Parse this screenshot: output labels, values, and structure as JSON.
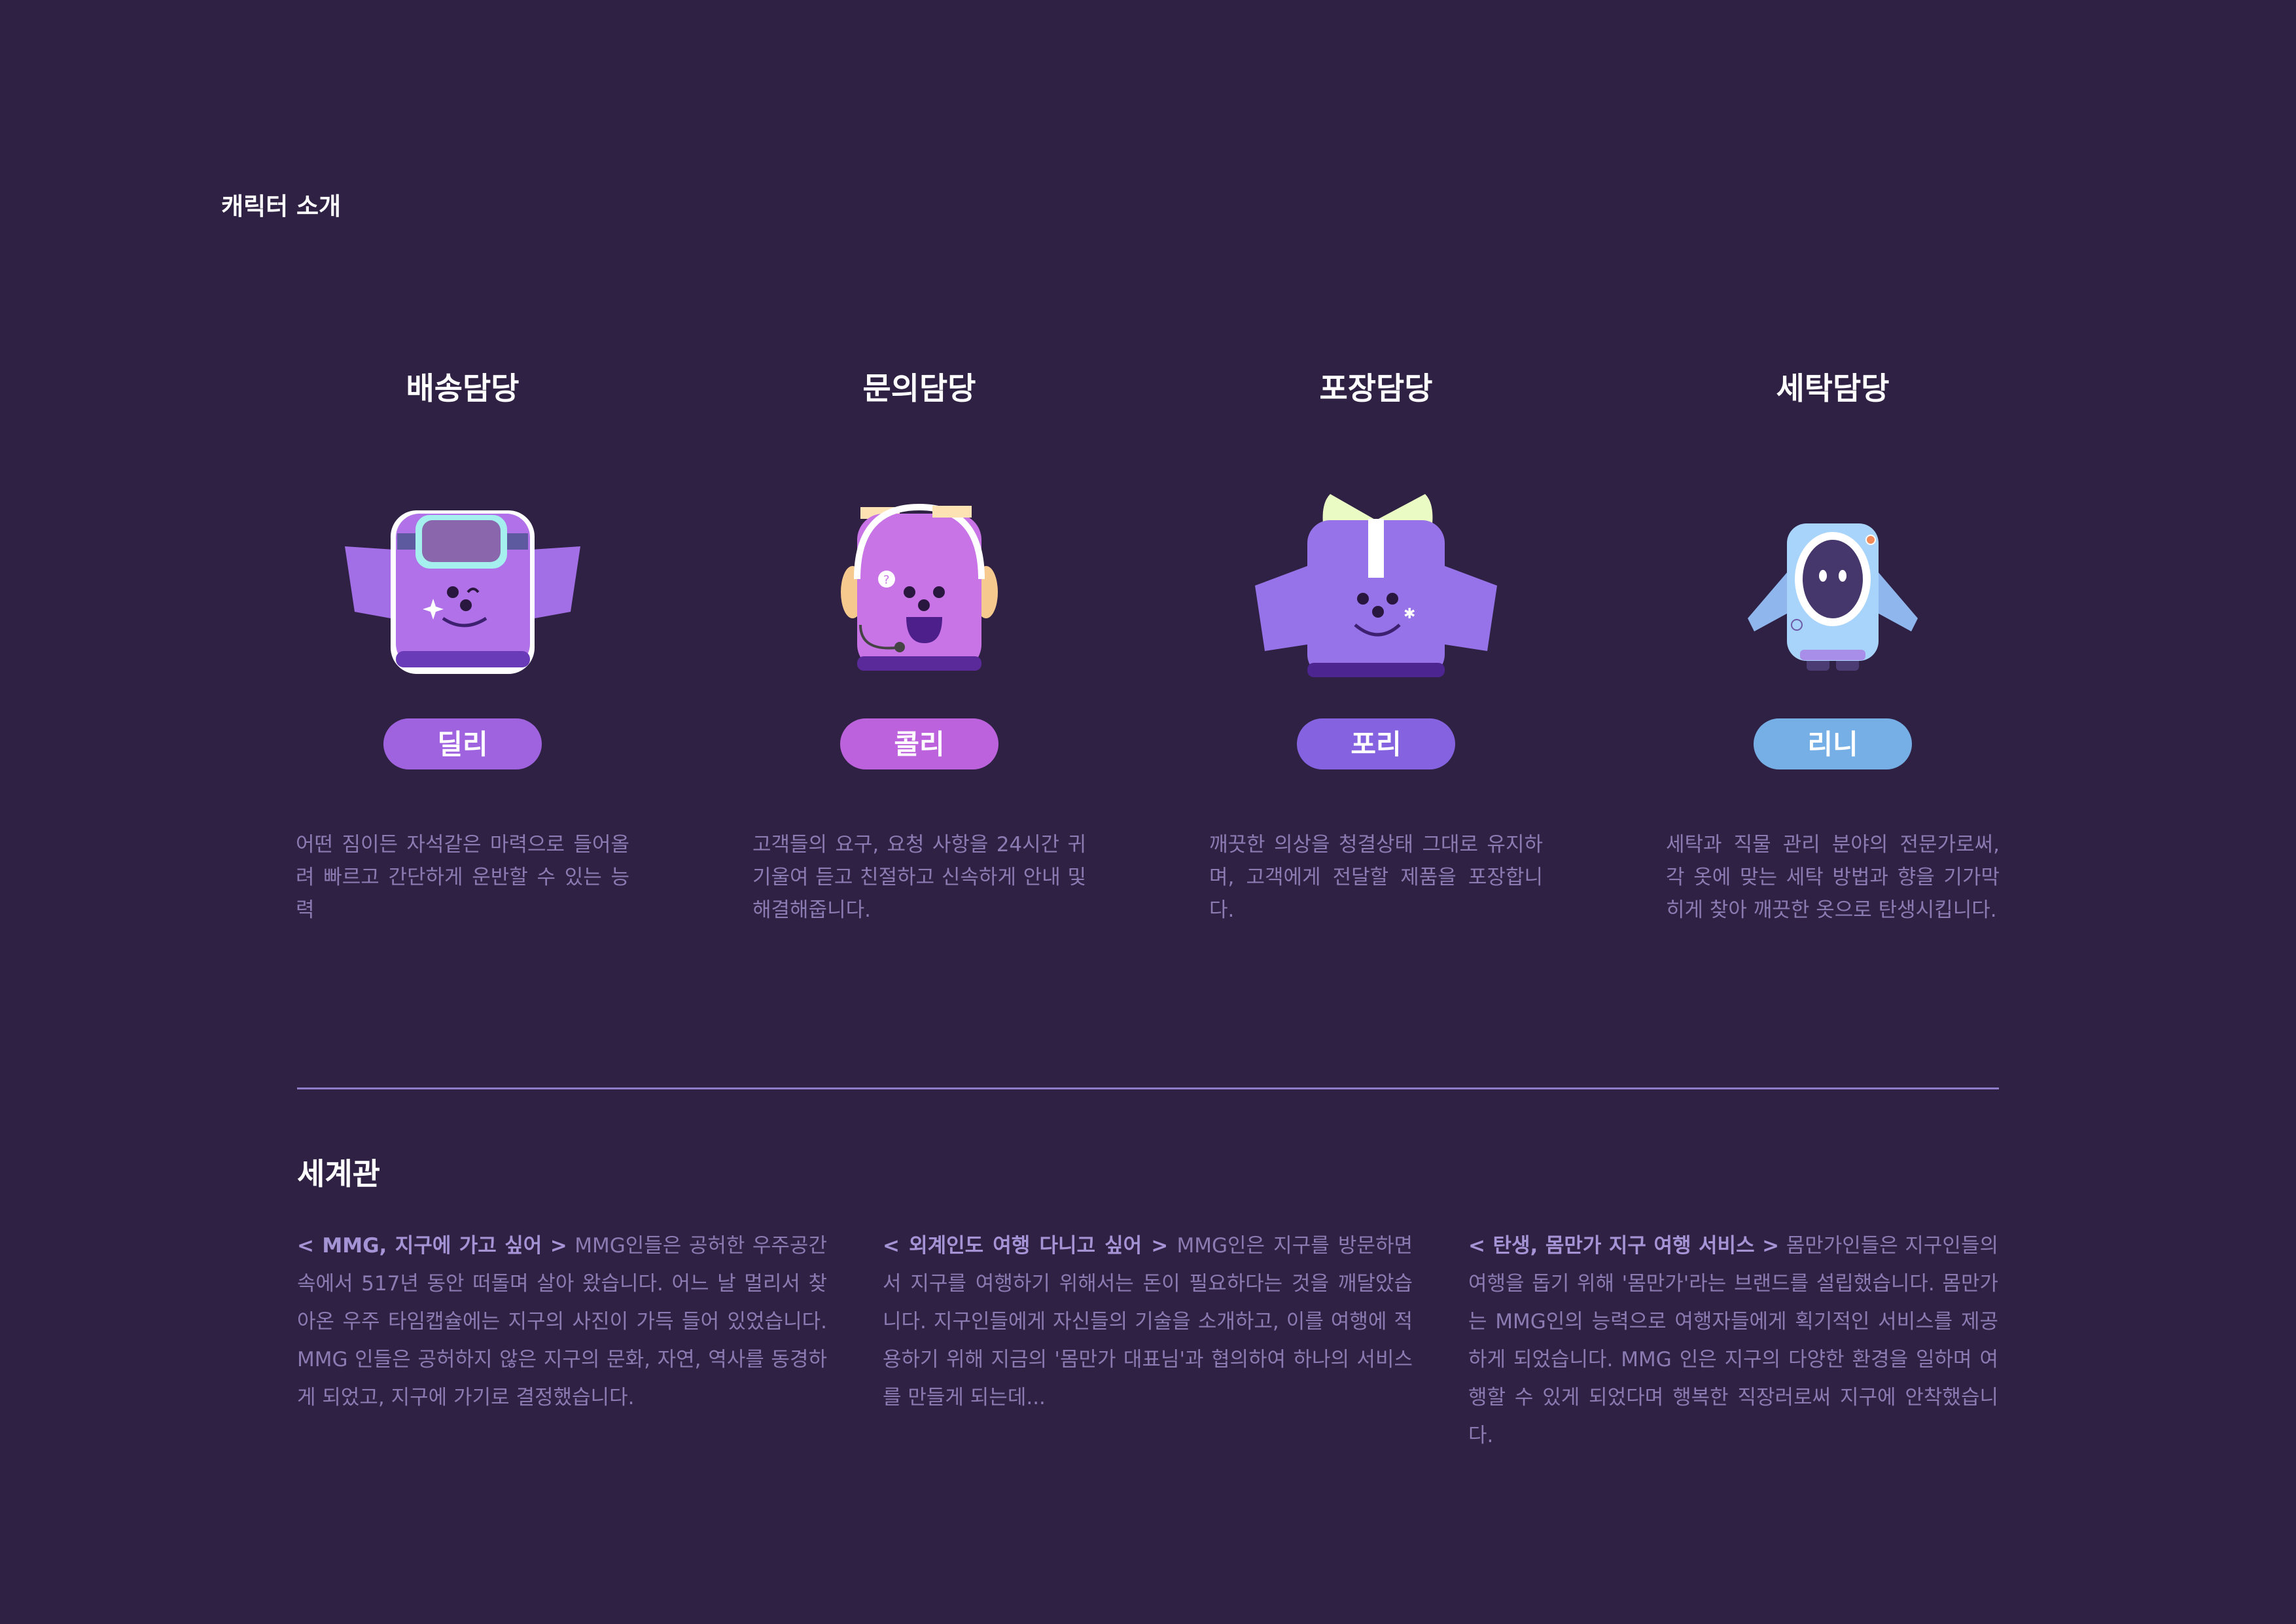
{
  "section_title": "캐릭터 소개",
  "characters": [
    {
      "role": "배송담당",
      "name": "딜리",
      "color": "#a063e0",
      "icon": "goggles-character",
      "desc": "어떤 짐이든 자석같은 마력으로 들어올려 빠르고 간단하게 운반할 수 있는 능력"
    },
    {
      "role": "문의담당",
      "name": "콜리",
      "color": "#bb62dc",
      "icon": "headset-character",
      "desc": "고객들의 요구, 요청 사항을 24시간 귀 기울여 듣고 친절하고 신속하게 안내 및 해결해줍니다."
    },
    {
      "role": "포장담당",
      "name": "포리",
      "color": "#8462e0",
      "icon": "ribbon-character",
      "desc": "깨끗한 의상을 청결상태 그대로 유지하며, 고객에게 전달할 제품을 포장합니다."
    },
    {
      "role": "세탁담당",
      "name": "리니",
      "color": "#76aee6",
      "icon": "washing-machine-character",
      "desc": "세탁과 직물 관리 분야의 전문가로써, 각 옷에 맞는 세탁 방법과 향을 기가막히게 찾아 깨끗한 옷으로 탄생시킵니다."
    }
  ],
  "worldview": {
    "title": "세계관",
    "items": [
      {
        "heading": "< MMG, 지구에 가고 싶어 >",
        "body": "MMG인들은 공허한 우주공간 속에서 517년 동안 떠돌며 살아 왔습니다. 어느 날 멀리서 찾아온 우주 타임캡슐에는 지구의 사진이 가득 들어 있었습니다. MMG 인들은 공허하지 않은 지구의 문화, 자연, 역사를 동경하게 되었고, 지구에 가기로 결정했습니다."
      },
      {
        "heading": "< 외계인도 여행 다니고 싶어 >",
        "body": "MMG인은 지구를 방문하면서 지구를 여행하기 위해서는 돈이 필요하다는 것을 깨달았습니다. 지구인들에게 자신들의 기술을 소개하고, 이를 여행에 적용하기 위해 지금의 '몸만가 대표님'과 협의하여 하나의 서비스를 만들게 되는데..."
      },
      {
        "heading": "< 탄생, 몸만가 지구 여행 서비스 >",
        "body": "몸만가인들은 지구인들의 여행을 돕기 위해 '몸만가'라는 브랜드를 설립했습니다. 몸만가는 MMG인의 능력으로 여행자들에게 획기적인 서비스를 제공하게 되었습니다. MMG 인은 지구의 다양한 환경을 일하며 여행할 수 있게 되었다며 행복한 직장러로써 지구에 안착했습니다."
      }
    ]
  }
}
